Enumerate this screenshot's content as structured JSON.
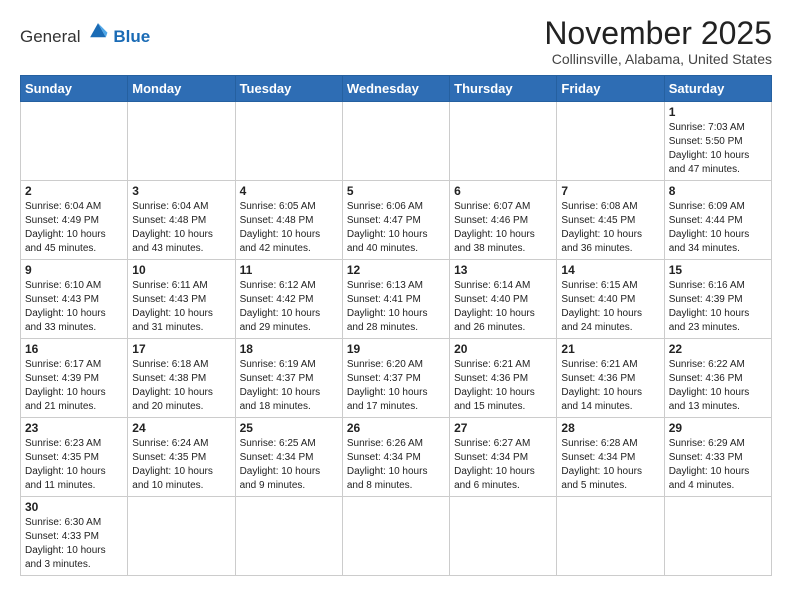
{
  "logo": {
    "part1": "General",
    "part2": "Blue"
  },
  "title": "November 2025",
  "location": "Collinsville, Alabama, United States",
  "weekdays": [
    "Sunday",
    "Monday",
    "Tuesday",
    "Wednesday",
    "Thursday",
    "Friday",
    "Saturday"
  ],
  "weeks": [
    [
      {
        "day": "",
        "info": ""
      },
      {
        "day": "",
        "info": ""
      },
      {
        "day": "",
        "info": ""
      },
      {
        "day": "",
        "info": ""
      },
      {
        "day": "",
        "info": ""
      },
      {
        "day": "",
        "info": ""
      },
      {
        "day": "1",
        "info": "Sunrise: 7:03 AM\nSunset: 5:50 PM\nDaylight: 10 hours\nand 47 minutes."
      }
    ],
    [
      {
        "day": "2",
        "info": "Sunrise: 6:04 AM\nSunset: 4:49 PM\nDaylight: 10 hours\nand 45 minutes."
      },
      {
        "day": "3",
        "info": "Sunrise: 6:04 AM\nSunset: 4:48 PM\nDaylight: 10 hours\nand 43 minutes."
      },
      {
        "day": "4",
        "info": "Sunrise: 6:05 AM\nSunset: 4:48 PM\nDaylight: 10 hours\nand 42 minutes."
      },
      {
        "day": "5",
        "info": "Sunrise: 6:06 AM\nSunset: 4:47 PM\nDaylight: 10 hours\nand 40 minutes."
      },
      {
        "day": "6",
        "info": "Sunrise: 6:07 AM\nSunset: 4:46 PM\nDaylight: 10 hours\nand 38 minutes."
      },
      {
        "day": "7",
        "info": "Sunrise: 6:08 AM\nSunset: 4:45 PM\nDaylight: 10 hours\nand 36 minutes."
      },
      {
        "day": "8",
        "info": "Sunrise: 6:09 AM\nSunset: 4:44 PM\nDaylight: 10 hours\nand 34 minutes."
      }
    ],
    [
      {
        "day": "9",
        "info": "Sunrise: 6:10 AM\nSunset: 4:43 PM\nDaylight: 10 hours\nand 33 minutes."
      },
      {
        "day": "10",
        "info": "Sunrise: 6:11 AM\nSunset: 4:43 PM\nDaylight: 10 hours\nand 31 minutes."
      },
      {
        "day": "11",
        "info": "Sunrise: 6:12 AM\nSunset: 4:42 PM\nDaylight: 10 hours\nand 29 minutes."
      },
      {
        "day": "12",
        "info": "Sunrise: 6:13 AM\nSunset: 4:41 PM\nDaylight: 10 hours\nand 28 minutes."
      },
      {
        "day": "13",
        "info": "Sunrise: 6:14 AM\nSunset: 4:40 PM\nDaylight: 10 hours\nand 26 minutes."
      },
      {
        "day": "14",
        "info": "Sunrise: 6:15 AM\nSunset: 4:40 PM\nDaylight: 10 hours\nand 24 minutes."
      },
      {
        "day": "15",
        "info": "Sunrise: 6:16 AM\nSunset: 4:39 PM\nDaylight: 10 hours\nand 23 minutes."
      }
    ],
    [
      {
        "day": "16",
        "info": "Sunrise: 6:17 AM\nSunset: 4:39 PM\nDaylight: 10 hours\nand 21 minutes."
      },
      {
        "day": "17",
        "info": "Sunrise: 6:18 AM\nSunset: 4:38 PM\nDaylight: 10 hours\nand 20 minutes."
      },
      {
        "day": "18",
        "info": "Sunrise: 6:19 AM\nSunset: 4:37 PM\nDaylight: 10 hours\nand 18 minutes."
      },
      {
        "day": "19",
        "info": "Sunrise: 6:20 AM\nSunset: 4:37 PM\nDaylight: 10 hours\nand 17 minutes."
      },
      {
        "day": "20",
        "info": "Sunrise: 6:21 AM\nSunset: 4:36 PM\nDaylight: 10 hours\nand 15 minutes."
      },
      {
        "day": "21",
        "info": "Sunrise: 6:21 AM\nSunset: 4:36 PM\nDaylight: 10 hours\nand 14 minutes."
      },
      {
        "day": "22",
        "info": "Sunrise: 6:22 AM\nSunset: 4:36 PM\nDaylight: 10 hours\nand 13 minutes."
      }
    ],
    [
      {
        "day": "23",
        "info": "Sunrise: 6:23 AM\nSunset: 4:35 PM\nDaylight: 10 hours\nand 11 minutes."
      },
      {
        "day": "24",
        "info": "Sunrise: 6:24 AM\nSunset: 4:35 PM\nDaylight: 10 hours\nand 10 minutes."
      },
      {
        "day": "25",
        "info": "Sunrise: 6:25 AM\nSunset: 4:34 PM\nDaylight: 10 hours\nand 9 minutes."
      },
      {
        "day": "26",
        "info": "Sunrise: 6:26 AM\nSunset: 4:34 PM\nDaylight: 10 hours\nand 8 minutes."
      },
      {
        "day": "27",
        "info": "Sunrise: 6:27 AM\nSunset: 4:34 PM\nDaylight: 10 hours\nand 6 minutes."
      },
      {
        "day": "28",
        "info": "Sunrise: 6:28 AM\nSunset: 4:34 PM\nDaylight: 10 hours\nand 5 minutes."
      },
      {
        "day": "29",
        "info": "Sunrise: 6:29 AM\nSunset: 4:33 PM\nDaylight: 10 hours\nand 4 minutes."
      }
    ],
    [
      {
        "day": "30",
        "info": "Sunrise: 6:30 AM\nSunset: 4:33 PM\nDaylight: 10 hours\nand 3 minutes."
      },
      {
        "day": "",
        "info": ""
      },
      {
        "day": "",
        "info": ""
      },
      {
        "day": "",
        "info": ""
      },
      {
        "day": "",
        "info": ""
      },
      {
        "day": "",
        "info": ""
      },
      {
        "day": "",
        "info": ""
      }
    ]
  ]
}
